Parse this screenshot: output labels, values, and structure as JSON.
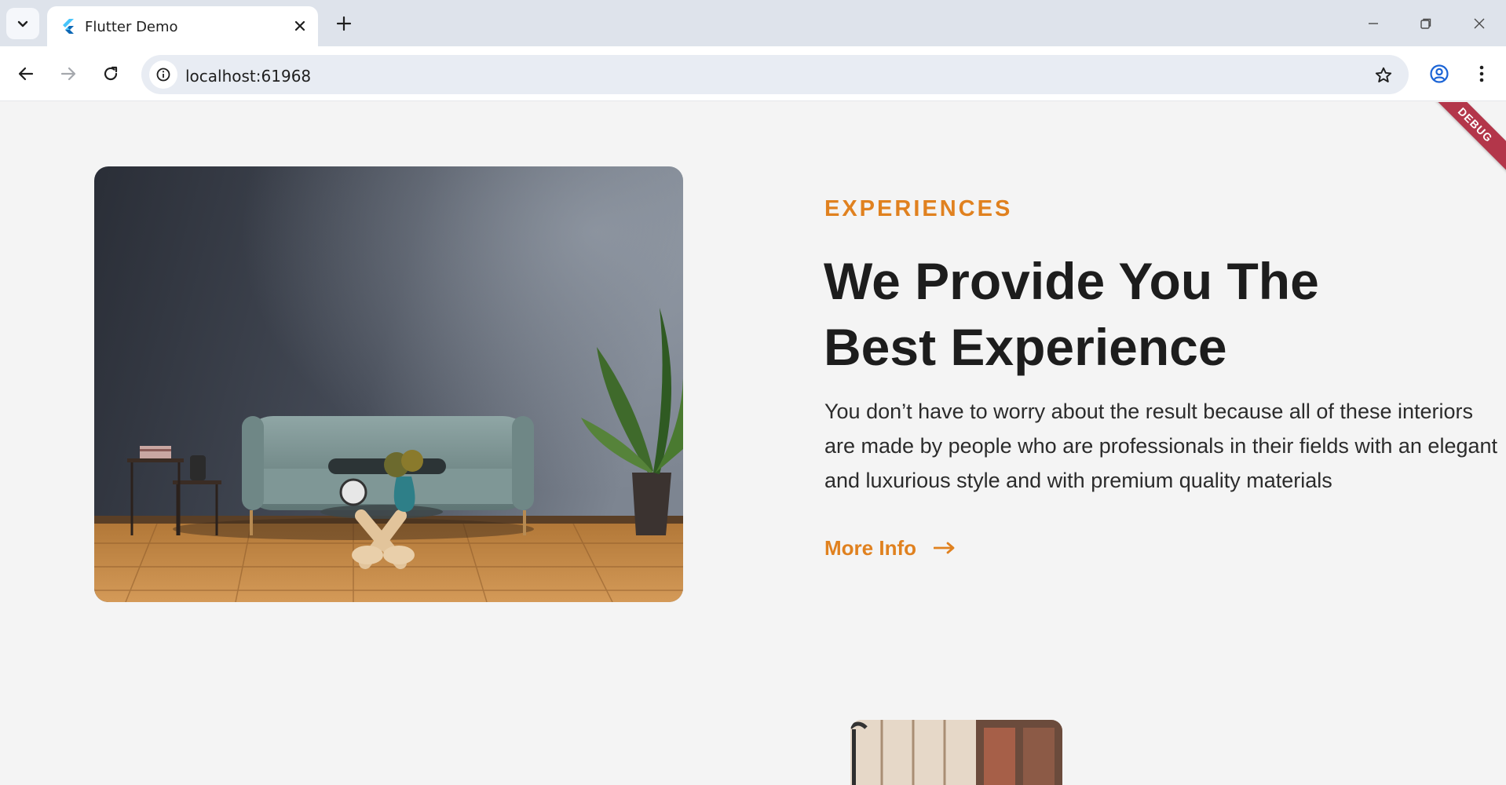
{
  "browser": {
    "tab_title": "Flutter Demo",
    "url": "localhost:61968",
    "icons": [
      "chevron-down-icon",
      "flutter-logo-icon",
      "close-icon",
      "plus-icon",
      "minimize-icon",
      "restore-icon",
      "window-close-icon",
      "back-arrow-icon",
      "forward-arrow-icon",
      "reload-icon",
      "site-info-icon",
      "bookmark-star-icon",
      "profile-icon",
      "more-menu-icon"
    ]
  },
  "debug_banner": "DEBUG",
  "hero": {
    "eyebrow": "EXPERIENCES",
    "headline": "We Provide You The Best Experience",
    "body": "You don’t have to worry about the result because all of these interiors are made by people who are professionals in their fields with an elegant and luxurious style and with premium quality materials",
    "cta_label": "More Info",
    "accent_color": "#e0811f",
    "text_color": "#1d1d1d"
  }
}
